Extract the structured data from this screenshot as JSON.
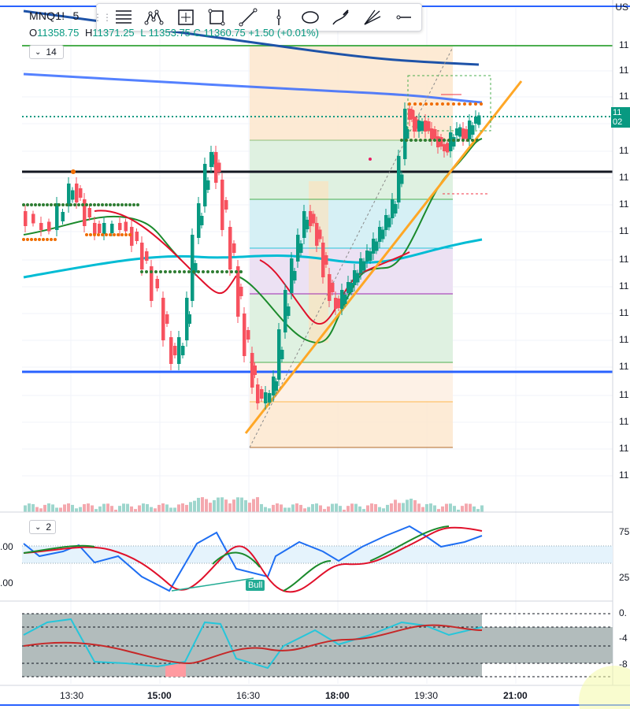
{
  "symbol": {
    "ticker": "MNQ1!",
    "interval": "5"
  },
  "ohlc": {
    "o_label": "O",
    "o_value": "11358.75",
    "h_label": "H",
    "h_value": "11371.25",
    "rest": "L 11353.75  C 11360.75  +1.50 (+0.01%)"
  },
  "top_right_label": "US",
  "main_pane": {
    "indicator_count": "14"
  },
  "osc_pane": {
    "indicator_count": "2",
    "bull_label": "Bull",
    "left_labels": [
      ".00",
      ".00"
    ],
    "right_labels": [
      "75",
      "25"
    ]
  },
  "lower_pane": {
    "right_labels": [
      "0.",
      "-4",
      "-8"
    ]
  },
  "price_scale": {
    "visible_prefix": "11",
    "current_tag": [
      "11",
      "02"
    ]
  },
  "time_axis": [
    "13:30",
    "15:00",
    "16:30",
    "18:00",
    "19:30",
    "21:00"
  ],
  "toolbar": {
    "tools": [
      "horizontal-lines-icon",
      "pattern-icon",
      "measure-box-icon",
      "rectangle-icon",
      "trend-line-icon",
      "vertical-line-icon",
      "ellipse-icon",
      "brush-icon",
      "fib-fan-icon",
      "horizontal-ray-icon"
    ]
  },
  "colors": {
    "bull": "#089981",
    "bear": "#f23645",
    "blue_level": "#2962ff",
    "orange": "#ff9800",
    "cyan": "#00bcd4",
    "ma_green": "#1b8a2c",
    "ma_red": "#e0102a",
    "zone_green": "#dff1e1",
    "zone_blue": "#d6f0f5",
    "zone_orange": "#fde6cc",
    "zone_purple": "#ece1f3"
  },
  "chart_data": {
    "type": "candlestick",
    "note_units": "prices are shown only by leading '11' on the truncated axis",
    "candles_count": 110,
    "levels": [
      "support-blue",
      "resistance-black",
      "top-green",
      "vwap-blue"
    ]
  }
}
